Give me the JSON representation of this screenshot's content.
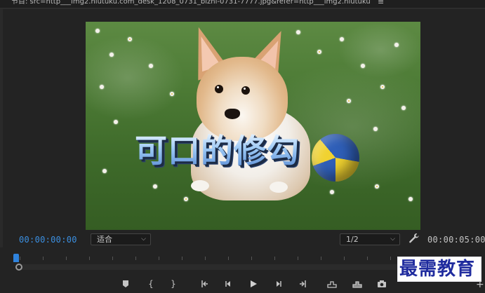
{
  "header": {
    "title": "节目: src=http___img2.niutuku.com_desk_1208_0731_bizhi-0731-7777.jpg&refer=http___img2.niutuku",
    "menu_icon": "hamburger-icon"
  },
  "viewer": {
    "overlay_text": "可口的修勾"
  },
  "controls": {
    "current_time": "00:00:00:00",
    "duration": "00:00:05:00",
    "zoom_select": "适合",
    "resolution_select": "1/2",
    "settings_icon": "wrench-icon"
  },
  "transport": {
    "buttons": [
      {
        "name": "add-marker-icon",
        "glyph": "⬟"
      },
      {
        "name": "mark-in-icon",
        "glyph": "{"
      },
      {
        "name": "mark-out-icon",
        "glyph": "}"
      },
      {
        "name": "go-to-in-icon",
        "glyph": "{←"
      },
      {
        "name": "step-back-icon",
        "glyph": "◂|"
      },
      {
        "name": "play-icon",
        "glyph": "▶"
      },
      {
        "name": "step-forward-icon",
        "glyph": "|▸"
      },
      {
        "name": "go-to-out-icon",
        "glyph": "→}"
      },
      {
        "name": "insert-icon",
        "glyph": "⊓"
      },
      {
        "name": "overwrite-icon",
        "glyph": "⊓"
      },
      {
        "name": "export-frame-icon",
        "glyph": "◉"
      }
    ],
    "add_button": "+"
  },
  "watermark": {
    "text": "最需教育"
  },
  "colors": {
    "timecode_active": "#3b8fe0",
    "panel_bg": "#232323",
    "watermark_text": "#1f2b9e"
  }
}
